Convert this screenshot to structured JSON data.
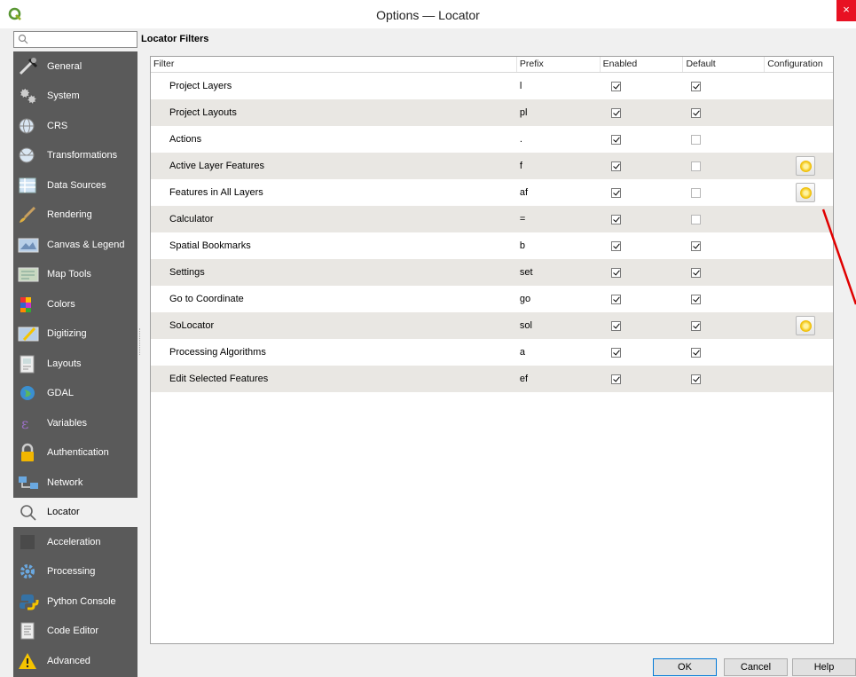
{
  "window": {
    "title": "Options — Locator",
    "close_label": "×"
  },
  "search": {
    "placeholder": ""
  },
  "sidebar": {
    "items": [
      {
        "label": "General",
        "icon": "wrench-icon"
      },
      {
        "label": "System",
        "icon": "gears-icon"
      },
      {
        "label": "CRS",
        "icon": "globe-icon"
      },
      {
        "label": "Transformations",
        "icon": "globe-transform-icon"
      },
      {
        "label": "Data Sources",
        "icon": "table-icon"
      },
      {
        "label": "Rendering",
        "icon": "paintbrush-icon"
      },
      {
        "label": "Canvas & Legend",
        "icon": "canvas-icon"
      },
      {
        "label": "Map Tools",
        "icon": "map-tools-icon"
      },
      {
        "label": "Colors",
        "icon": "palette-icon"
      },
      {
        "label": "Digitizing",
        "icon": "digitizing-icon"
      },
      {
        "label": "Layouts",
        "icon": "layout-icon"
      },
      {
        "label": "GDAL",
        "icon": "gdal-globe-icon"
      },
      {
        "label": "Variables",
        "icon": "variables-icon"
      },
      {
        "label": "Authentication",
        "icon": "lock-icon"
      },
      {
        "label": "Network",
        "icon": "network-icon"
      },
      {
        "label": "Locator",
        "icon": "search-icon",
        "active": true
      },
      {
        "label": "Acceleration",
        "icon": "acceleration-icon"
      },
      {
        "label": "Processing",
        "icon": "processing-gear-icon"
      },
      {
        "label": "Python Console",
        "icon": "python-icon"
      },
      {
        "label": "Code Editor",
        "icon": "code-editor-icon"
      },
      {
        "label": "Advanced",
        "icon": "warning-icon"
      }
    ]
  },
  "main": {
    "section_title": "Locator Filters",
    "columns": [
      "Filter",
      "Prefix",
      "Enabled",
      "Default",
      "Configuration"
    ],
    "rows": [
      {
        "filter": "Project Layers",
        "prefix": "l",
        "enabled": true,
        "default": true,
        "config": false
      },
      {
        "filter": "Project Layouts",
        "prefix": "pl",
        "enabled": true,
        "default": true,
        "config": false
      },
      {
        "filter": "Actions",
        "prefix": ".",
        "enabled": true,
        "default": false,
        "config": false
      },
      {
        "filter": "Active Layer Features",
        "prefix": "f",
        "enabled": true,
        "default": false,
        "config": true
      },
      {
        "filter": "Features in All Layers",
        "prefix": "af",
        "enabled": true,
        "default": false,
        "config": true
      },
      {
        "filter": "Calculator",
        "prefix": "=",
        "enabled": true,
        "default": false,
        "config": false
      },
      {
        "filter": "Spatial Bookmarks",
        "prefix": "b",
        "enabled": true,
        "default": true,
        "config": false
      },
      {
        "filter": "Settings",
        "prefix": "set",
        "enabled": true,
        "default": true,
        "config": false
      },
      {
        "filter": "Go to Coordinate",
        "prefix": "go",
        "enabled": true,
        "default": true,
        "config": false
      },
      {
        "filter": "SoLocator",
        "prefix": "sol",
        "enabled": true,
        "default": true,
        "config": true
      },
      {
        "filter": "Processing Algorithms",
        "prefix": "a",
        "enabled": true,
        "default": true,
        "config": false
      },
      {
        "filter": "Edit Selected Features",
        "prefix": "ef",
        "enabled": true,
        "default": true,
        "config": false
      }
    ]
  },
  "buttons": {
    "ok": "OK",
    "cancel": "Cancel",
    "help": "Help"
  },
  "colors": {
    "sidebar_bg": "#5a5a5a",
    "close_bg": "#e81123",
    "row_alt": "#e9e7e3",
    "annotation": "#e00000"
  }
}
